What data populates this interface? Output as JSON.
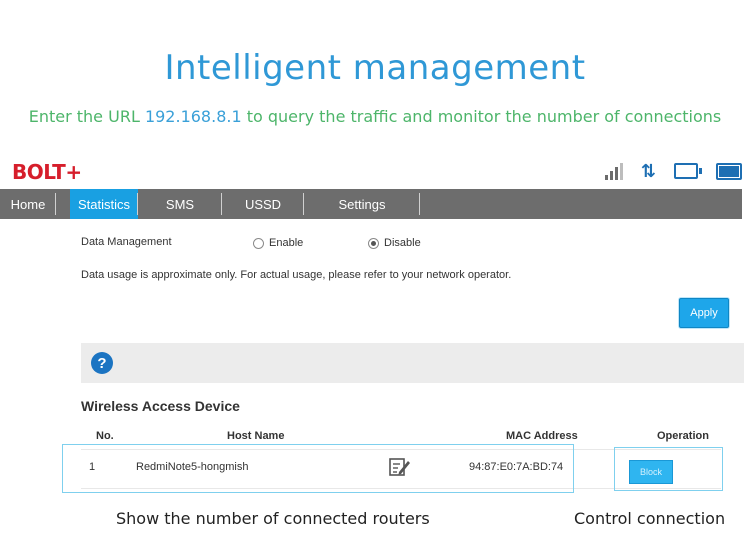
{
  "header": {
    "title": "Intelligent  management",
    "subtitle_pre": "Enter the URL ",
    "subtitle_url": "192.168.8.1",
    "subtitle_post": " to query the traffic and monitor the number of connections"
  },
  "brand": {
    "logo": "BOLT+"
  },
  "nav": {
    "items": [
      {
        "label": "Home"
      },
      {
        "label": "Statistics"
      },
      {
        "label": "SMS"
      },
      {
        "label": "USSD"
      },
      {
        "label": "Settings"
      }
    ],
    "active": "Statistics"
  },
  "data_management": {
    "label": "Data Management",
    "enable_label": "Enable",
    "disable_label": "Disable",
    "selected": "Disable",
    "note": "Data usage is approximate only. For actual usage, please refer to your network operator.",
    "apply_label": "Apply"
  },
  "help": {
    "icon_glyph": "?"
  },
  "devices": {
    "title": "Wireless Access Device",
    "columns": [
      "No.",
      "Host Name",
      "MAC Address",
      "Operation"
    ],
    "rows": [
      {
        "no": "1",
        "host": "RedmiNote5-hongmish",
        "mac": "94:87:E0:7A:BD:74",
        "action": "Block"
      }
    ]
  },
  "captions": {
    "left": "Show the number of connected routers",
    "right": "Control connection"
  },
  "colors": {
    "accent": "#19a0e2",
    "headline": "#2f98d6",
    "subtitle": "#4db56a",
    "navbar": "#6d6d6d",
    "logo": "#d61e2b"
  }
}
